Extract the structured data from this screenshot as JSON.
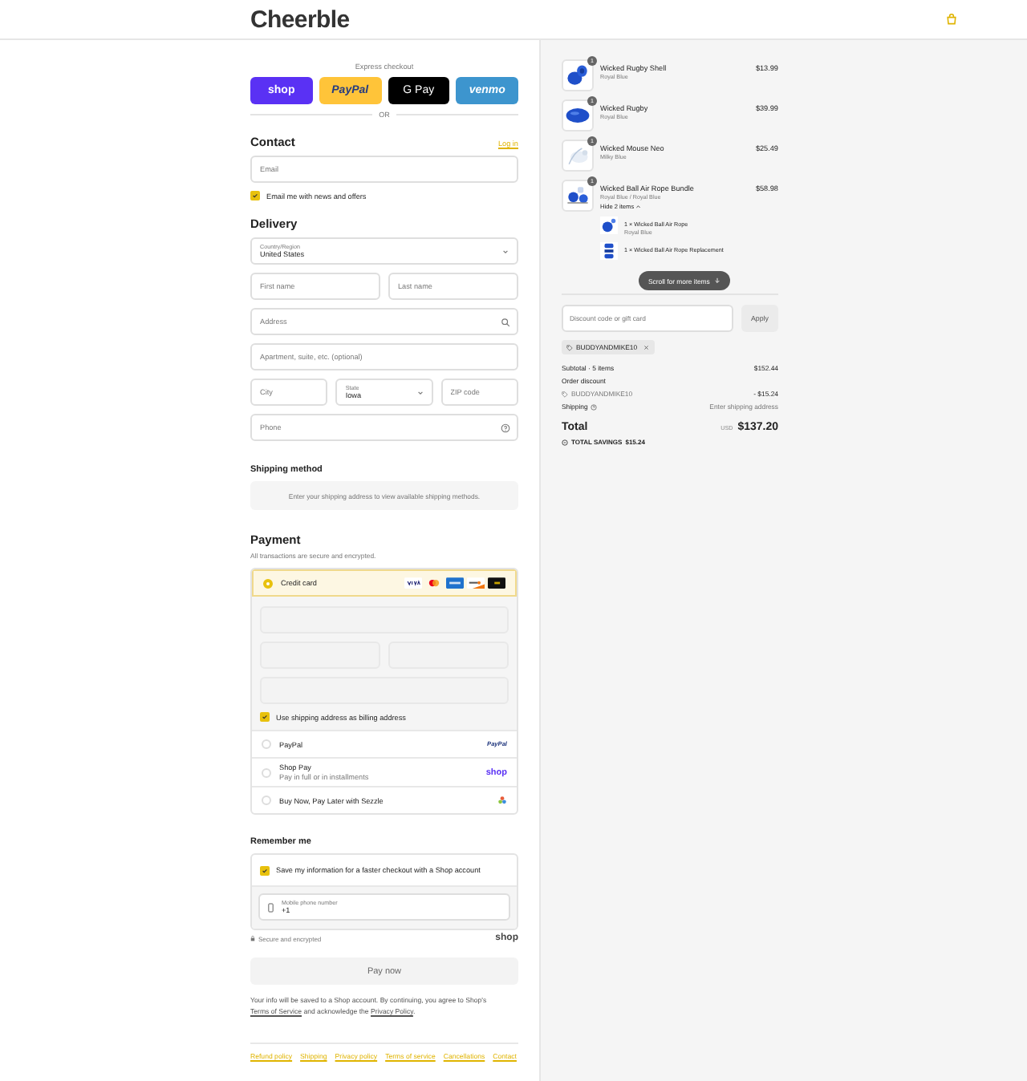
{
  "header": {
    "logo": "Cheerble"
  },
  "express": {
    "label": "Express checkout",
    "buttons": [
      {
        "kind": "shop",
        "label": "shop"
      },
      {
        "kind": "paypal",
        "label": "PayPal"
      },
      {
        "kind": "gpay",
        "label": "G Pay"
      },
      {
        "kind": "venmo",
        "label": "venmo"
      }
    ],
    "divider": "OR"
  },
  "contact": {
    "title": "Contact",
    "login": "Log in",
    "email": {
      "placeholder": "Email"
    },
    "newsletter": {
      "label": "Email me with news and offers",
      "checked": true
    }
  },
  "delivery": {
    "title": "Delivery",
    "rows": [
      [
        {
          "kind": "select",
          "label": "Country/Region",
          "value": "United States"
        }
      ],
      [
        {
          "kind": "input",
          "placeholder": "First name"
        },
        {
          "kind": "input",
          "placeholder": "Last name"
        }
      ],
      [
        {
          "kind": "search",
          "placeholder": "Address"
        }
      ],
      [
        {
          "kind": "input",
          "placeholder": "Apartment, suite, etc. (optional)"
        }
      ],
      [
        {
          "kind": "input",
          "placeholder": "City"
        },
        {
          "kind": "select",
          "label": "State",
          "value": "Iowa"
        },
        {
          "kind": "input",
          "placeholder": "ZIP code"
        }
      ],
      [
        {
          "kind": "help",
          "placeholder": "Phone"
        }
      ]
    ]
  },
  "shipping_method": {
    "title": "Shipping method",
    "message": "Enter your shipping address to view available shipping methods."
  },
  "payment": {
    "title": "Payment",
    "subtitle": "All transactions are secure and encrypted.",
    "methods": [
      {
        "kind": "card",
        "label": "Credit card",
        "selected": true
      },
      {
        "kind": "paypal",
        "label": "PayPal",
        "brand": "PayPal",
        "selected": false
      },
      {
        "kind": "shoppay",
        "label": "Shop Pay",
        "sublabel": "Pay in full or in installments",
        "brand": "shop",
        "selected": false
      },
      {
        "kind": "sezzle",
        "label": "Buy Now, Pay Later with Sezzle",
        "selected": false
      }
    ],
    "billing": {
      "label": "Use shipping address as billing address",
      "checked": true
    }
  },
  "remember": {
    "title": "Remember me",
    "save": {
      "label": "Save my information for a faster checkout with a Shop account",
      "checked": true
    },
    "phone": {
      "label": "Mobile phone number",
      "value": "+1"
    },
    "secure": "Secure and encrypted",
    "brand": "shop"
  },
  "pay_button": "Pay now",
  "legal": [
    {
      "text": "Your info will be saved to a Shop account. By continuing, you agree to Shop's "
    },
    {
      "link": "Terms of Service"
    },
    {
      "text": " and acknowledge the "
    },
    {
      "link": "Privacy Policy"
    },
    {
      "text": "."
    }
  ],
  "footer_links": [
    "Refund policy",
    "Shipping",
    "Privacy policy",
    "Terms of service",
    "Cancellations",
    "Contact"
  ],
  "cart": {
    "items": [
      {
        "name": "Wicked Rugby Shell",
        "variant": "Royal Blue",
        "price": "$13.99",
        "quantity": "1"
      },
      {
        "name": "Wicked Rugby",
        "variant": "Royal Blue",
        "price": "$39.99",
        "quantity": "1"
      },
      {
        "name": "Wicked Mouse Neo",
        "variant": "Milky Blue",
        "price": "$25.49",
        "quantity": "1"
      },
      {
        "name": "Wicked Ball Air Rope Bundle",
        "variant": "Royal Blue / Royal Blue",
        "price": "$58.98",
        "quantity": "1",
        "toggle": "Hide 2 items",
        "expanded": true,
        "components": [
          {
            "name": "1 × Wicked Ball Air Rope",
            "variant": "Royal Blue"
          },
          {
            "name": "1 × Wicked Ball Air Rope Replacement"
          }
        ]
      }
    ],
    "scroll_hint": "Scroll for more items"
  },
  "discount": {
    "placeholder": "Discount code or gift card",
    "apply": "Apply",
    "code": "BUDDYANDMIKE10"
  },
  "summary": {
    "subtotal_label": "Subtotal · 5 items",
    "subtotal": "$152.44",
    "discount_label": "Order discount",
    "discount_code": "BUDDYANDMIKE10",
    "discount": "- $15.24",
    "shipping_label": "Shipping",
    "shipping": "Enter shipping address",
    "total_label": "Total",
    "currency": "USD",
    "total": "$137.20",
    "savings_label": "TOTAL SAVINGS",
    "savings": "$15.24"
  }
}
